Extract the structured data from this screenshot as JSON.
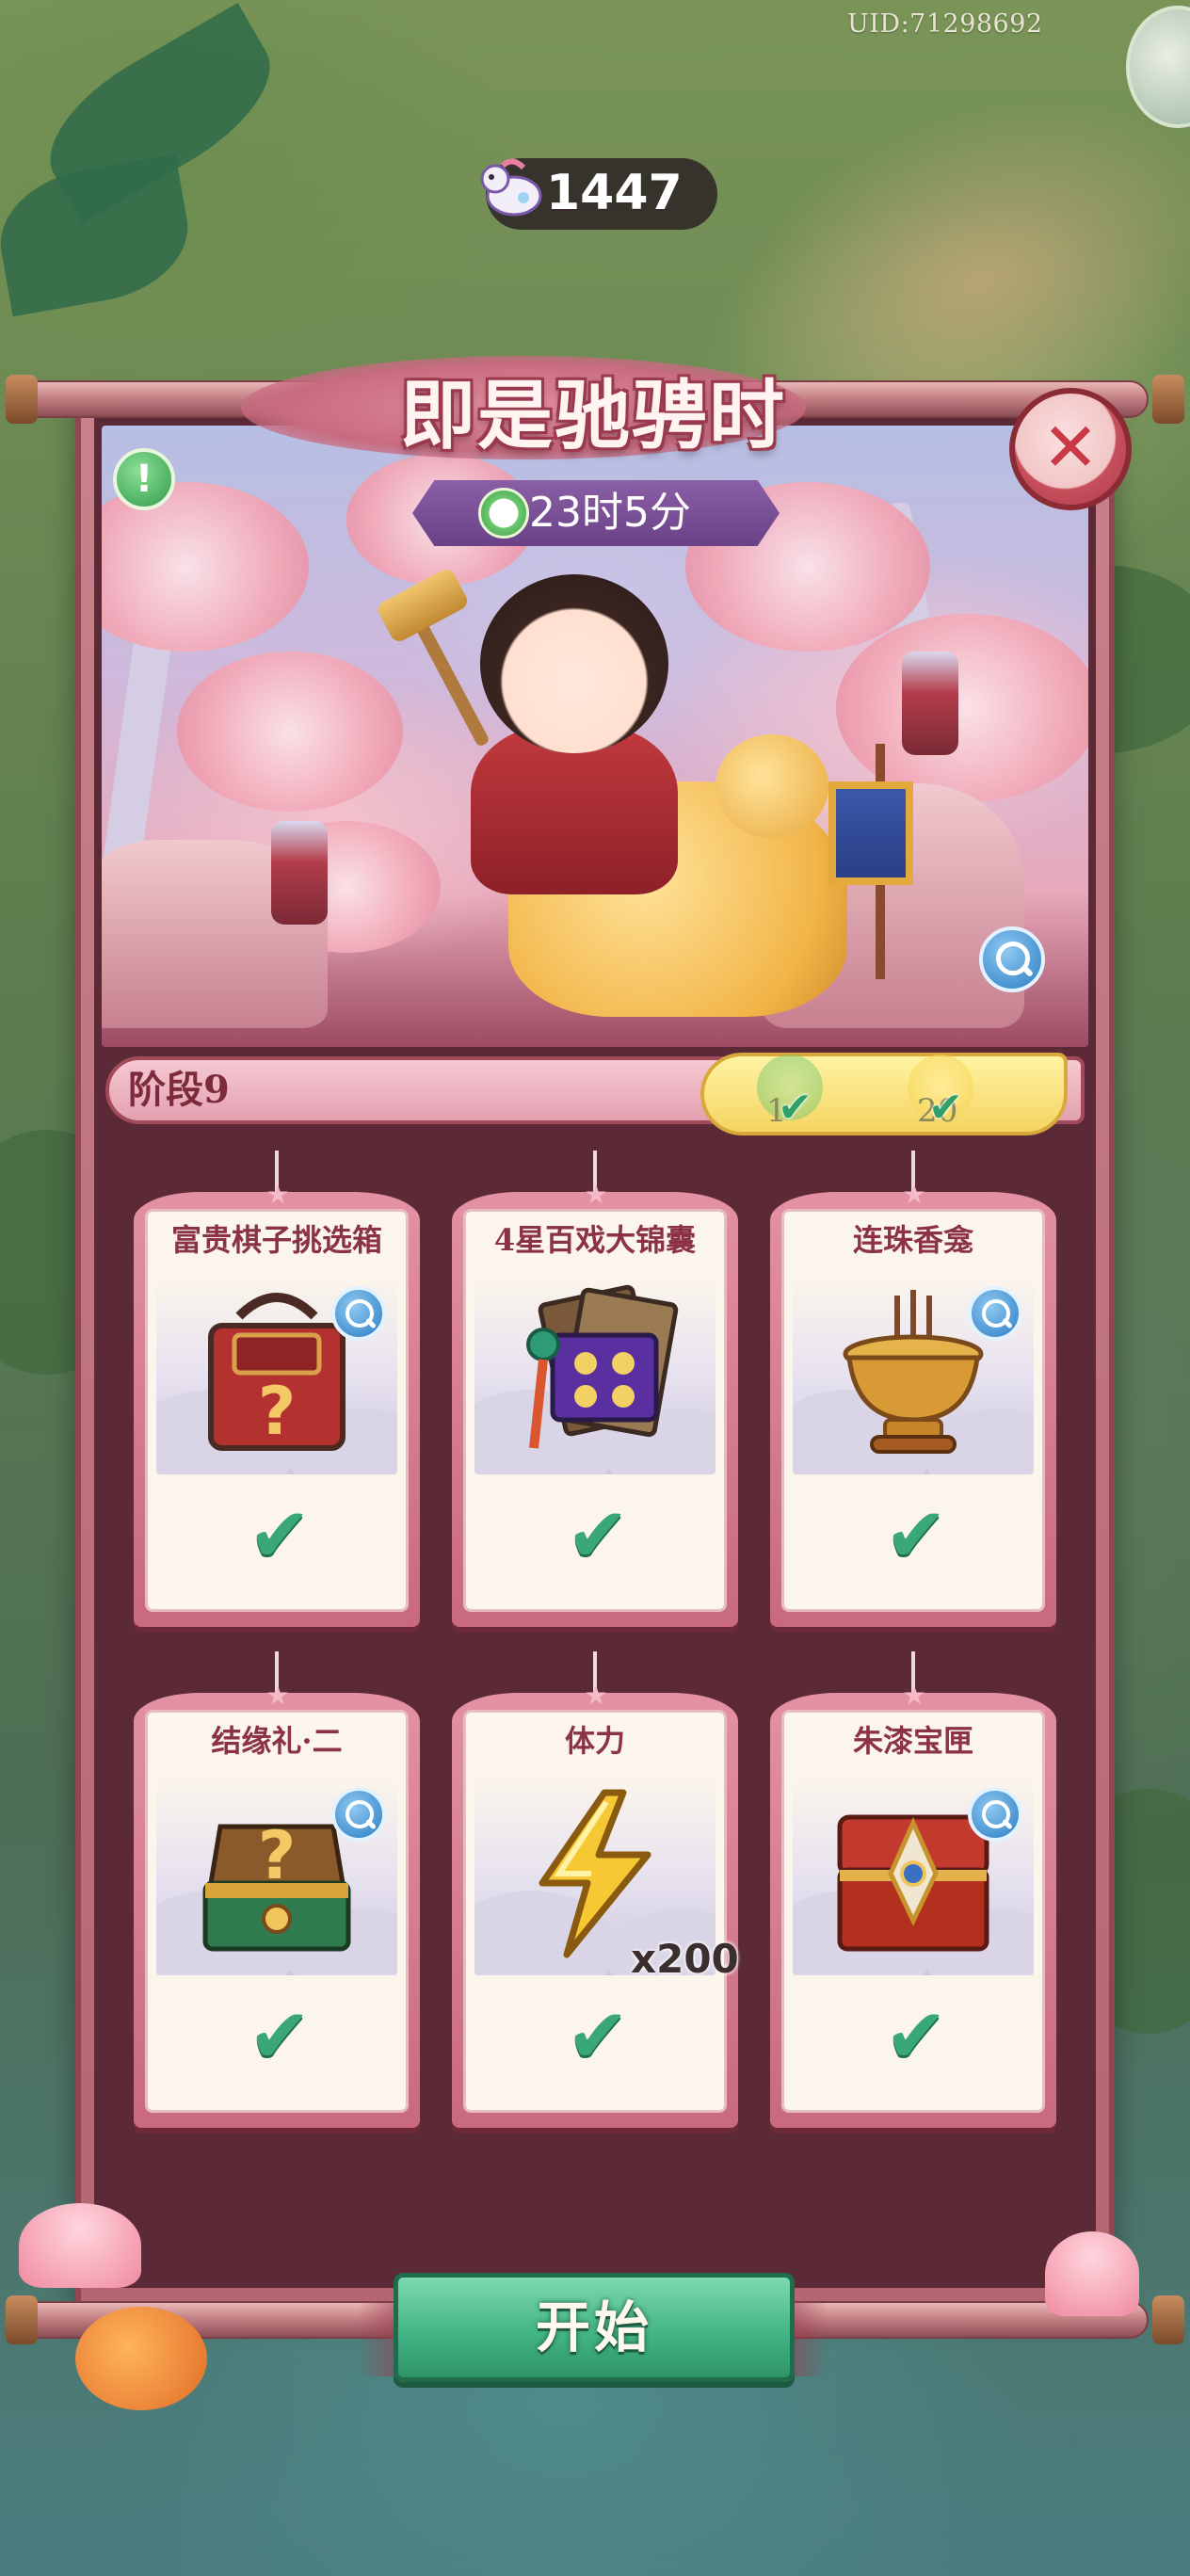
{
  "hud": {
    "uid_text": "UID:71298692",
    "currency": {
      "icon": "pony-token-icon",
      "value": "1447"
    }
  },
  "event": {
    "title": "即是驰骋时",
    "timer": {
      "icon": "timer-icon",
      "text": "23时5分"
    },
    "stage_label": "阶段9",
    "milestones": [
      {
        "number": "1",
        "icon": "clover-icon",
        "claimed": true
      },
      {
        "number": "20",
        "icon": "lightning-icon",
        "claimed": true
      }
    ]
  },
  "rewards": [
    {
      "name": "富贵棋子挑选箱",
      "icon": "red-mystery-chest-icon",
      "quantity": "",
      "has_zoom": true,
      "claimed": true
    },
    {
      "name": "4星百戏大锦囊",
      "icon": "purple-pouch-icon",
      "quantity": "",
      "has_zoom": false,
      "claimed": true
    },
    {
      "name": "连珠香龛",
      "icon": "incense-burner-icon",
      "quantity": "",
      "has_zoom": true,
      "claimed": true
    },
    {
      "name": "结缘礼·二",
      "icon": "green-mystery-chest-icon",
      "quantity": "",
      "has_zoom": true,
      "claimed": true
    },
    {
      "name": "体力",
      "icon": "lightning-bolt-icon",
      "quantity": "x200",
      "has_zoom": false,
      "claimed": true
    },
    {
      "name": "朱漆宝匣",
      "icon": "red-lacquer-chest-icon",
      "quantity": "",
      "has_zoom": true,
      "claimed": true
    }
  ],
  "actions": {
    "start_label": "开始",
    "close_icon": "close-icon",
    "info_icon": "exclamation-icon",
    "zoom_icon": "magnifier-icon"
  },
  "colors": {
    "frame": "#c9818a",
    "panel": "#5b2a36",
    "card_title": "#8b3245",
    "check": "#3aa77b",
    "start_button": "#43b687",
    "timer_bg": "#6a4187"
  }
}
